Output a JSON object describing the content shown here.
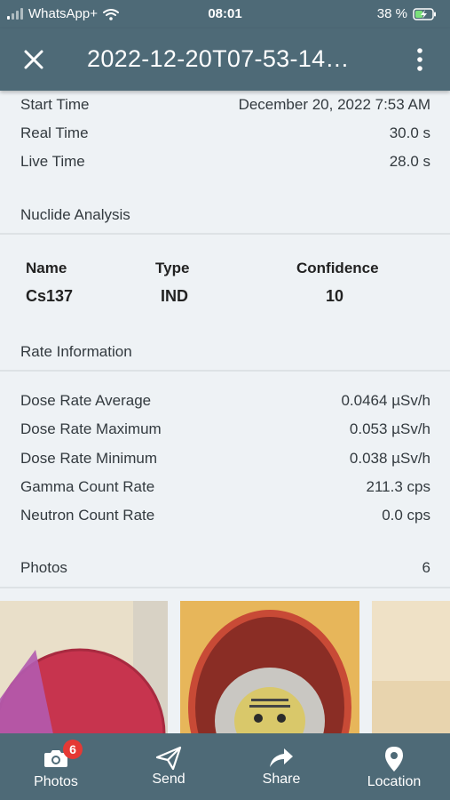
{
  "status_bar": {
    "carrier": "WhatsApp+",
    "time": "08:01",
    "battery": "38 %"
  },
  "app_bar": {
    "title": "2022-12-20T07-53-14…"
  },
  "details": [
    {
      "label": "Start Time",
      "value": "December 20, 2022 7:53 AM"
    },
    {
      "label": "Real Time",
      "value": "30.0 s"
    },
    {
      "label": "Live Time",
      "value": "28.0 s"
    }
  ],
  "nuclide_analysis": {
    "section_label": "Nuclide Analysis",
    "headers": {
      "name": "Name",
      "type": "Type",
      "confidence": "Confidence"
    },
    "rows": [
      {
        "name": "Cs137",
        "type": "IND",
        "confidence": "10"
      }
    ]
  },
  "rate_information": {
    "section_label": "Rate Information",
    "rows": [
      {
        "label": "Dose Rate Average",
        "value": "0.0464 µSv/h"
      },
      {
        "label": "Dose Rate Maximum",
        "value": "0.053 µSv/h"
      },
      {
        "label": "Dose Rate Minimum",
        "value": "0.038 µSv/h"
      },
      {
        "label": "Gamma Count Rate",
        "value": "211.3 cps"
      },
      {
        "label": "Neutron Count Rate",
        "value": "0.0 cps"
      }
    ]
  },
  "photos": {
    "label": "Photos",
    "count": "6"
  },
  "bottom_nav": [
    {
      "label": "Photos",
      "icon": "camera-icon",
      "badge": "6"
    },
    {
      "label": "Send",
      "icon": "send-icon"
    },
    {
      "label": "Share",
      "icon": "share-icon"
    },
    {
      "label": "Location",
      "icon": "location-pin-icon"
    }
  ],
  "colors": {
    "primary": "#4e6a77",
    "background": "#eef2f5",
    "badge": "#e53935"
  }
}
